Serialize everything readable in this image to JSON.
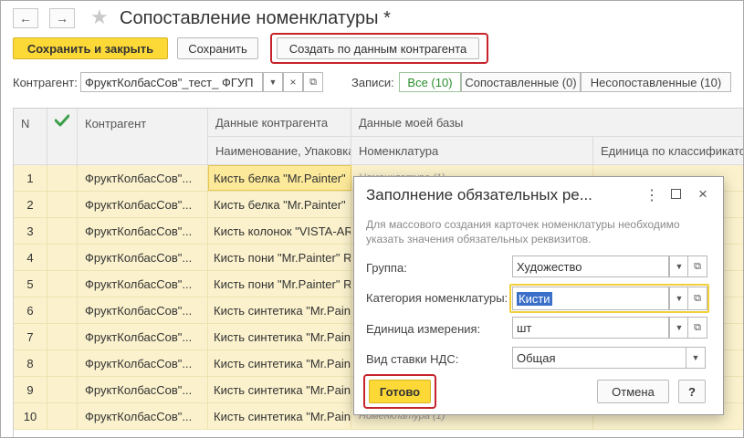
{
  "window": {
    "title": "Сопоставление номенклатуры *",
    "back_icon": "←",
    "forward_icon": "→",
    "star_icon": "★"
  },
  "toolbar": {
    "save_close": "Сохранить и закрыть",
    "save": "Сохранить",
    "create_by_counterparty": "Создать по данным контрагента"
  },
  "filter": {
    "counterparty_label": "Контрагент:",
    "counterparty_value": "ФруктКолбасСов\"_тест_ ФГУП",
    "records_label": "Записи:",
    "segments": [
      "Все (10)",
      "Сопоставленные (0)",
      "Несопоставленные (10)"
    ]
  },
  "table": {
    "headers": {
      "n": "N",
      "counterparty": "Контрагент",
      "cp_data": "Данные контрагента",
      "cp_data_sub": "Наименование, Упаковка",
      "my_db": "Данные моей базы",
      "nomenclature": "Номенклатура",
      "unit": "Единица по классификатору"
    },
    "rows": [
      {
        "n": "1",
        "counterparty": "ФруктКолбасСов\"...",
        "name": "Кисть белка \"Mr.Painter\"",
        "nom": "Номенклатура (1)"
      },
      {
        "n": "2",
        "counterparty": "ФруктКолбасСов\"...",
        "name": "Кисть белка \"Mr.Painter\"",
        "nom": ""
      },
      {
        "n": "3",
        "counterparty": "ФруктКолбасСов\"...",
        "name": "Кисть колонок \"VISTA-ARTISTA\"",
        "nom": ""
      },
      {
        "n": "4",
        "counterparty": "ФруктКолбасСов\"...",
        "name": "Кисть пони \"Mr.Painter\" R",
        "nom": ""
      },
      {
        "n": "5",
        "counterparty": "ФруктКолбасСов\"...",
        "name": "Кисть пони \"Mr.Painter\" R",
        "nom": ""
      },
      {
        "n": "6",
        "counterparty": "ФруктКолбасСов\"...",
        "name": "Кисть синтетика \"Mr.Painter\"",
        "nom": ""
      },
      {
        "n": "7",
        "counterparty": "ФруктКолбасСов\"...",
        "name": "Кисть синтетика \"Mr.Painter\"",
        "nom": ""
      },
      {
        "n": "8",
        "counterparty": "ФруктКолбасСов\"...",
        "name": "Кисть синтетика \"Mr.Painter\"",
        "nom": ""
      },
      {
        "n": "9",
        "counterparty": "ФруктКолбасСов\"...",
        "name": "Кисть синтетика \"Mr.Painter\"",
        "nom": ""
      },
      {
        "n": "10",
        "counterparty": "ФруктКолбасСов\"...",
        "name": "Кисть синтетика \"Mr.Painter\"",
        "nom": "Номенклатура (1)"
      }
    ]
  },
  "dialog": {
    "title": "Заполнение обязательных ре...",
    "description": "Для массового создания карточек номенклатуры необходимо указать значения обязательных реквизитов.",
    "fields": [
      {
        "label": "Группа:",
        "value": "Художество"
      },
      {
        "label": "Категория номенклатуры:",
        "value": "Кисти"
      },
      {
        "label": "Единица измерения:",
        "value": "шт"
      },
      {
        "label": "Вид ставки НДС:",
        "value": "Общая"
      }
    ],
    "ok": "Готово",
    "cancel": "Отмена",
    "help": "?"
  },
  "colors": {
    "accent_yellow": "#fcd937",
    "highlight_red": "#c7232b",
    "row_bg": "#fbf2cd",
    "active_green": "#2a8d2a"
  }
}
